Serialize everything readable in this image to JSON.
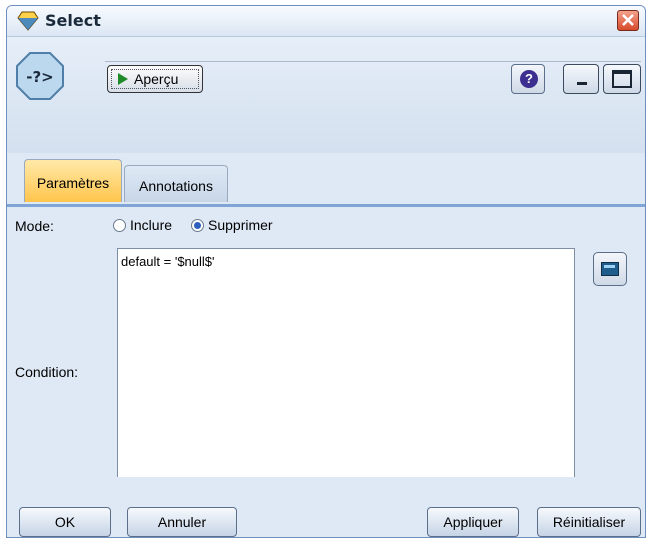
{
  "window": {
    "title": "Select"
  },
  "toolbar": {
    "preview_label": "Aperçu",
    "help_glyph": "?"
  },
  "tabs": [
    {
      "label": "Paramètres",
      "active": true
    },
    {
      "label": "Annotations",
      "active": false
    }
  ],
  "mode": {
    "label": "Mode:",
    "options": [
      {
        "label": "Inclure",
        "selected": false
      },
      {
        "label": "Supprimer",
        "selected": true
      }
    ]
  },
  "condition": {
    "label": "Condition:",
    "value": "default = '$null$'"
  },
  "buttons": {
    "ok": "OK",
    "cancel": "Annuler",
    "apply": "Appliquer",
    "reset": "Réinitialiser"
  },
  "colors": {
    "active_tab": "#ffc54d",
    "window_bg": "#dfe9f5",
    "close": "#d64a2b"
  },
  "icons": [
    "diamond-node-icon",
    "close-icon",
    "play-icon",
    "help-icon",
    "minimize-icon",
    "maximize-icon",
    "calculator-icon",
    "select-node-icon"
  ]
}
